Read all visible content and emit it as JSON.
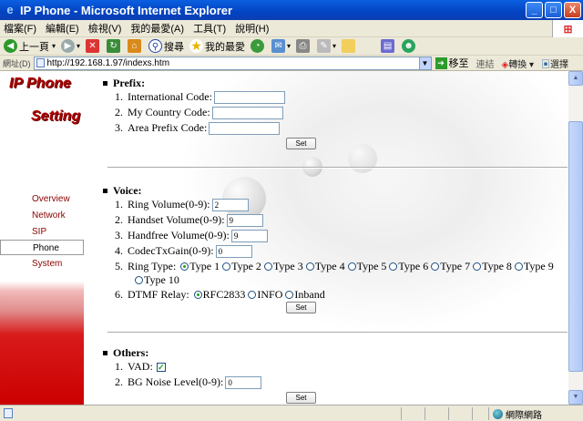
{
  "window": {
    "title": "IP Phone - Microsoft Internet Explorer",
    "min": "_",
    "max": "□",
    "close": "X"
  },
  "menu": [
    "檔案(F)",
    "編輯(E)",
    "檢視(V)",
    "我的最愛(A)",
    "工具(T)",
    "說明(H)"
  ],
  "toolbar": {
    "back": "上一頁",
    "search": "搜尋",
    "favorites": "我的最愛"
  },
  "address": {
    "label": "網址(D)",
    "url": "http://192.168.1.97/indexs.htm",
    "go": "移至",
    "links": "連結",
    "convert": "轉換",
    "select": "選擇"
  },
  "sidebar": {
    "title1": "IP Phone",
    "title2": "Setting",
    "items": [
      {
        "label": "Overview"
      },
      {
        "label": "Network"
      },
      {
        "label": "SIP"
      },
      {
        "label": "Phone"
      },
      {
        "label": "System"
      }
    ]
  },
  "prefix": {
    "heading": "Prefix:",
    "rows": [
      {
        "num": "1.",
        "label": "International Code:",
        "value": ""
      },
      {
        "num": "2.",
        "label": "My Country Code:",
        "value": ""
      },
      {
        "num": "3.",
        "label": "Area Prefix Code:",
        "value": ""
      }
    ],
    "set": "Set"
  },
  "voice": {
    "heading": "Voice:",
    "rows": [
      {
        "num": "1.",
        "label": "Ring Volume(0-9):",
        "value": "2"
      },
      {
        "num": "2.",
        "label": "Handset Volume(0-9):",
        "value": "9"
      },
      {
        "num": "3.",
        "label": "Handfree Volume(0-9):",
        "value": "9"
      },
      {
        "num": "4.",
        "label": "CodecTxGain(0-9):",
        "value": "0"
      }
    ],
    "ring_type": {
      "num": "5.",
      "label": "Ring Type:",
      "options": [
        "Type 1",
        "Type 2",
        "Type 3",
        "Type 4",
        "Type 5",
        "Type 6",
        "Type 7",
        "Type 8",
        "Type 9",
        "Type 10"
      ],
      "selected": "Type 1"
    },
    "dtmf": {
      "num": "6.",
      "label": "DTMF Relay:",
      "options": [
        "RFC2833",
        "INFO",
        "Inband"
      ],
      "selected": "RFC2833"
    },
    "set": "Set"
  },
  "others": {
    "heading": "Others:",
    "vad": {
      "num": "1.",
      "label": "VAD:",
      "checked": true
    },
    "bg": {
      "num": "2.",
      "label": "BG Noise Level(0-9):",
      "value": "0"
    },
    "set": "Set"
  },
  "status": {
    "zone": "網際網路"
  }
}
